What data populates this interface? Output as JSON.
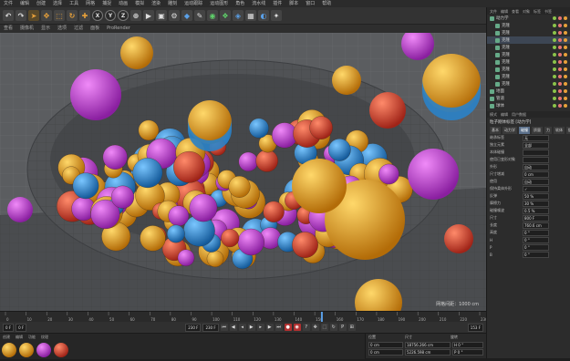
{
  "menubar": {
    "items": [
      "文件",
      "编辑",
      "创建",
      "选择",
      "工具",
      "网格",
      "捕捉",
      "动画",
      "模拟",
      "渲染",
      "雕刻",
      "运动跟踪",
      "运动图形",
      "角色",
      "流水线",
      "插件",
      "脚本",
      "窗口",
      "帮助"
    ]
  },
  "toolbar": {
    "xyz": [
      "X",
      "Y",
      "Z"
    ]
  },
  "viewport": {
    "menu": [
      "查看",
      "摄像机",
      "显示",
      "选项",
      "过滤",
      "面板",
      "ProRender"
    ],
    "grid_label": "网格间距：1000 cm"
  },
  "object_manager": {
    "tabs": [
      "文件",
      "编辑",
      "查看",
      "对象",
      "标签",
      "书签"
    ],
    "rows": [
      {
        "label": "动力学",
        "selected": false
      },
      {
        "label": "克隆",
        "selected": false
      },
      {
        "label": "克隆",
        "selected": false
      },
      {
        "label": "克隆",
        "selected": true
      },
      {
        "label": "克隆",
        "selected": false
      },
      {
        "label": "克隆",
        "selected": false
      },
      {
        "label": "克隆",
        "selected": false
      },
      {
        "label": "克隆",
        "selected": false
      },
      {
        "label": "克隆",
        "selected": false
      },
      {
        "label": "克隆",
        "selected": false
      },
      {
        "label": "地面",
        "selected": false
      },
      {
        "label": "管道",
        "selected": false
      },
      {
        "label": "球体",
        "selected": false
      }
    ]
  },
  "attributes": {
    "header": [
      "模式",
      "编辑",
      "用户数据"
    ],
    "title": "粒子刚体标签 [动力学]",
    "tabs": [
      "基本",
      "动力学",
      "碰撞",
      "质量",
      "力",
      "软体",
      "缓存"
    ],
    "active_tab": "碰撞",
    "params": [
      {
        "label": "继承标签",
        "value": "无"
      },
      {
        "label": "独立元素",
        "value": "全部"
      },
      {
        "label": "本体碰撞",
        "value": ""
      },
      {
        "label": "使用已变形对象",
        "value": ""
      },
      {
        "label": "外形",
        "value": "自动"
      },
      {
        "label": "尺寸增减",
        "value": "0 cm"
      },
      {
        "label": "使用",
        "value": "自动"
      },
      {
        "label": "保持柔体外形",
        "value": "✓"
      },
      {
        "label": "反弹",
        "value": "50 %"
      },
      {
        "label": "摩擦力",
        "value": "30 %"
      },
      {
        "label": "碰撞噪波",
        "value": "0.5 %"
      }
    ],
    "props": [
      {
        "label": "尺寸",
        "value": "800 F"
      },
      {
        "label": "长度",
        "value": "760.6 cm"
      },
      {
        "label": "高度",
        "value": "0 °"
      },
      {
        "label": "H",
        "value": "0 °"
      },
      {
        "label": "P",
        "value": "0 °"
      },
      {
        "label": "B",
        "value": "0 °"
      }
    ]
  },
  "timeline": {
    "ticks": [
      "0",
      "10",
      "20",
      "30",
      "40",
      "50",
      "60",
      "70",
      "80",
      "90",
      "100",
      "110",
      "120",
      "130",
      "140",
      "150",
      "160",
      "170",
      "180",
      "190",
      "200",
      "210",
      "220",
      "230"
    ],
    "start_field": "0 F",
    "current_field": "0 F",
    "end_field": "230 F",
    "end2_field": "230 F",
    "frame_field": "153 F"
  },
  "material_manager": {
    "tabs": [
      "创建",
      "编辑",
      "功能",
      "纹理"
    ]
  },
  "coordinates": {
    "headers": [
      "位置",
      "尺寸",
      "旋转"
    ],
    "rows": [
      {
        "a": "0 cm",
        "b": "18756.266 cm",
        "c": "H 0 °"
      },
      {
        "a": "0 cm",
        "b": "5226.598 cm",
        "c": "P 0 °"
      }
    ]
  },
  "colors": {
    "viewport_bg": "#5b5d60",
    "bowl": "#4d4f52",
    "ball_magenta": "#c03cd6",
    "ball_orange": "#e8a01e",
    "ball_blue": "#2a82c8",
    "ball_red": "#d8452c",
    "accent": "#e8a13a"
  }
}
